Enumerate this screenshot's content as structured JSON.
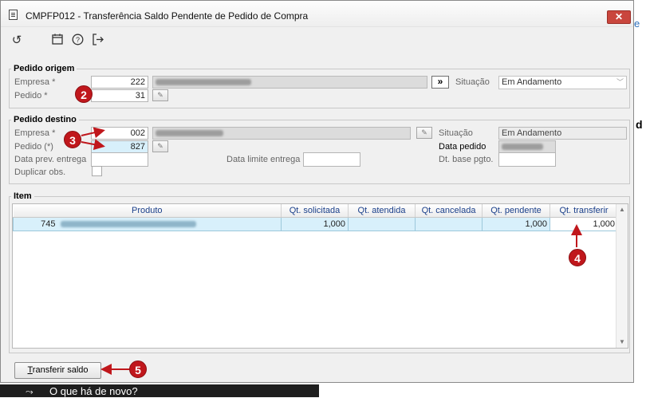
{
  "window": {
    "title": "CMPFP012 - Transferência Saldo Pendente de Pedido de Compra",
    "close_label": "✕"
  },
  "toolbar": {
    "icons": [
      "undo-icon",
      "calendar-icon",
      "help-icon",
      "exit-icon"
    ]
  },
  "origem": {
    "legend": "Pedido origem",
    "empresa_label": "Empresa *",
    "empresa_value": "222",
    "pedido_label": "Pedido *",
    "pedido_value": "31",
    "nav_label": "»",
    "situacao_label": "Situação",
    "situacao_value": "Em Andamento"
  },
  "destino": {
    "legend": "Pedido destino",
    "empresa_label": "Empresa *",
    "empresa_value": "002",
    "pedido_label": "Pedido (*)",
    "pedido_value": "827",
    "prev_entrega_label": "Data prev. entrega",
    "limite_entrega_label": "Data limite entrega",
    "duplicar_label": "Duplicar obs.",
    "situacao_label": "Situação",
    "situacao_value": "Em Andamento",
    "data_pedido_label": "Data pedido",
    "dt_base_label": "Dt. base pgto."
  },
  "item": {
    "legend": "Item",
    "columns": [
      "Produto",
      "Qt. solicitada",
      "Qt. atendida",
      "Qt. cancelada",
      "Qt. pendente",
      "Qt. transferir"
    ],
    "rows": [
      {
        "codigo": "745",
        "solicitada": "1,000",
        "atendida": "",
        "cancelada": "",
        "pendente": "1,000",
        "transferir": "1,000"
      }
    ]
  },
  "actions": {
    "transfer_label": "Transferir saldo",
    "transfer_mnemonic": "T",
    "transfer_rest": "ransferir saldo"
  },
  "annotations": [
    "2",
    "3",
    "4",
    "5"
  ],
  "background": {
    "link_fragment": "e",
    "letter_fragment": "d",
    "taskbar_text": "O que há de novo?"
  },
  "colors": {
    "badge": "#c0171c",
    "row_highlight": "#d8f0fb",
    "header_text": "#1a3f8a"
  }
}
